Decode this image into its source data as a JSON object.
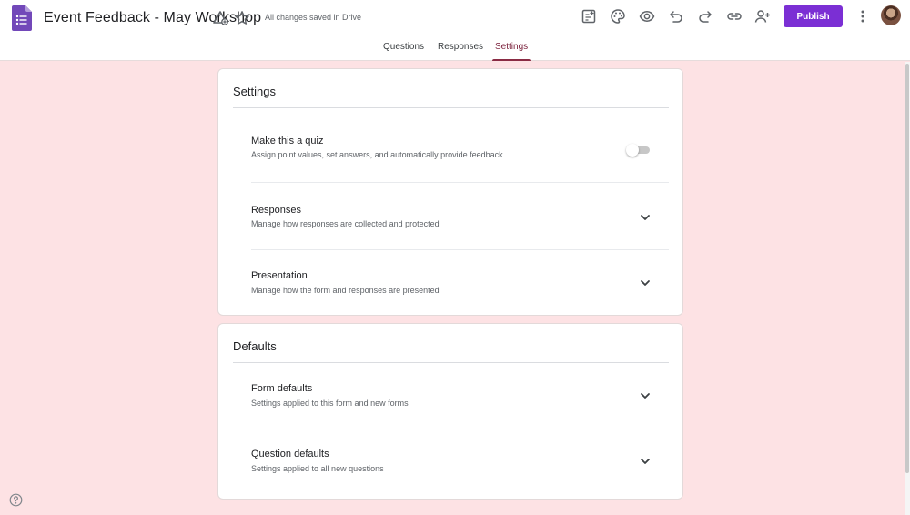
{
  "header": {
    "title": "Event Feedback - May Workshop",
    "save_status": "All changes saved in Drive",
    "publish_label": "Publish",
    "brand_color": "#7b2fd4",
    "icons": [
      "forms-logo-icon",
      "move-to-folder-icon",
      "star-icon",
      "customize-addon-icon",
      "palette-icon",
      "preview-eye-icon",
      "undo-icon",
      "redo-icon",
      "link-icon",
      "add-collaborator-icon",
      "more-vert-icon"
    ]
  },
  "tabs": [
    {
      "label": "Questions",
      "active": false
    },
    {
      "label": "Responses",
      "active": false
    },
    {
      "label": "Settings",
      "active": true
    }
  ],
  "settings": {
    "heading": "Settings",
    "quiz": {
      "title": "Make this a quiz",
      "description": "Assign point values, set answers, and automatically provide feedback",
      "enabled": false
    },
    "responses": {
      "title": "Responses",
      "description": "Manage how responses are collected and protected"
    },
    "presentation": {
      "title": "Presentation",
      "description": "Manage how the form and responses are presented"
    }
  },
  "defaults": {
    "heading": "Defaults",
    "form_defaults": {
      "title": "Form defaults",
      "description": "Settings applied to this form and new forms"
    },
    "question_defaults": {
      "title": "Question defaults",
      "description": "Settings applied to all new questions"
    }
  },
  "colors": {
    "page_background": "#fde2e4",
    "active_tab": "#8a2b44"
  }
}
